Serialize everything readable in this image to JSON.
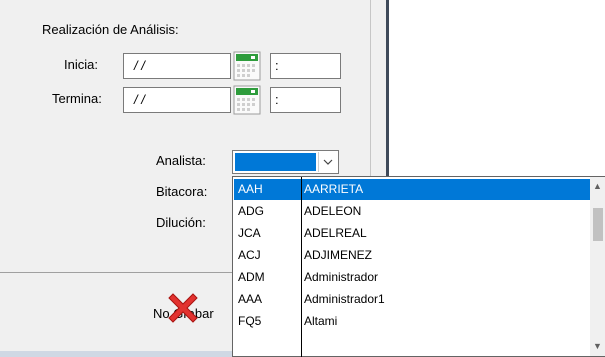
{
  "section": {
    "title": "Realización de Análisis:"
  },
  "fields": {
    "inicia": {
      "label": "Inicia:",
      "date_value": "/ /",
      "time_value": ":"
    },
    "termina": {
      "label": "Termina:",
      "date_value": "/ /",
      "time_value": ":"
    }
  },
  "labels": {
    "analista": "Analista:",
    "bitacora": "Bitacora:",
    "dilucion": "Dilución:"
  },
  "analista_combo": {
    "selected_value": ""
  },
  "dropdown": {
    "items": [
      {
        "code": "AAH",
        "name": "AARRIETA",
        "selected": true
      },
      {
        "code": "ADG",
        "name": "ADELEON"
      },
      {
        "code": "JCA",
        "name": "ADELREAL"
      },
      {
        "code": "ACJ",
        "name": "ADJIMENEZ"
      },
      {
        "code": "ADM",
        "name": "Administrador"
      },
      {
        "code": "AAA",
        "name": "Administrador1"
      },
      {
        "code": "FQ5",
        "name": "Altami"
      }
    ]
  },
  "footer": {
    "no_grabar_label": "No Grabar"
  },
  "colors": {
    "selection": "#0078d7",
    "panel": "#f0f0f0",
    "calendar_green": "#2e9c3c"
  },
  "icons": {
    "calendar": "calendar-icon",
    "cancel": "red-x-icon",
    "dropdown": "chevron-down-icon"
  }
}
